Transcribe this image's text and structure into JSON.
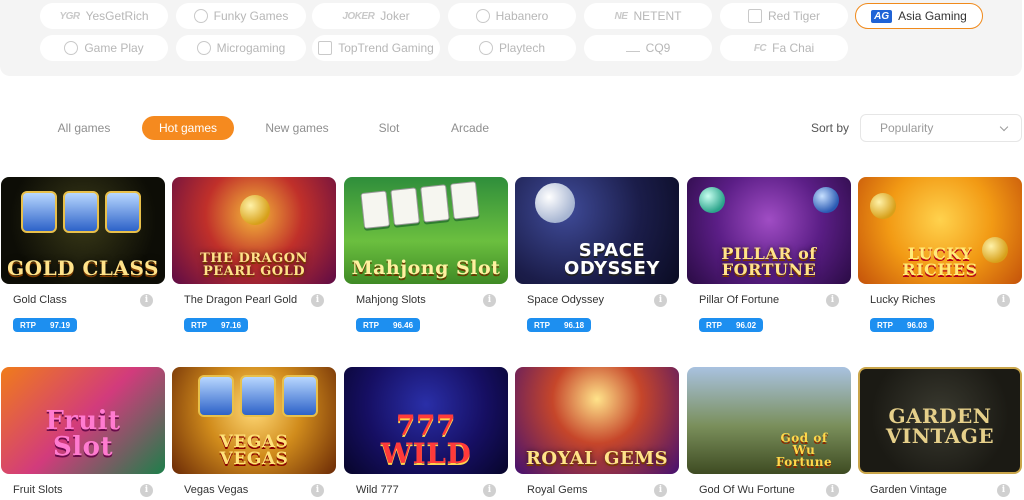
{
  "providers": [
    {
      "label": "YesGetRich",
      "icon": "ygr-logo-icon"
    },
    {
      "label": "Funky Games",
      "icon": "funky-games-logo-icon"
    },
    {
      "label": "Joker",
      "icon": "joker-logo-icon",
      "logo_text": "JOKER"
    },
    {
      "label": "Habanero",
      "icon": "habanero-logo-icon"
    },
    {
      "label": "NETENT",
      "icon": "netent-logo-icon",
      "logo_text": "NE"
    },
    {
      "label": "Red Tiger",
      "icon": "red-tiger-logo-icon"
    },
    {
      "label": "Asia Gaming",
      "icon": "asia-gaming-logo-icon",
      "logo_text": "AG",
      "active": true
    },
    {
      "label": "Game Play",
      "icon": "game-play-logo-icon"
    },
    {
      "label": "Microgaming",
      "icon": "microgaming-logo-icon"
    },
    {
      "label": "TopTrend Gaming",
      "icon": "toptrend-logo-icon"
    },
    {
      "label": "Playtech",
      "icon": "playtech-logo-icon"
    },
    {
      "label": "CQ9",
      "icon": "cq9-logo-icon"
    },
    {
      "label": "Fa Chai",
      "icon": "fa-chai-logo-icon",
      "logo_text": "FC"
    }
  ],
  "tabs": [
    {
      "label": "All games"
    },
    {
      "label": "Hot games",
      "active": true
    },
    {
      "label": "New games"
    },
    {
      "label": "Slot"
    },
    {
      "label": "Arcade"
    }
  ],
  "sort": {
    "label": "Sort by",
    "value": "Popularity"
  },
  "rtp_label": "RTP",
  "info_glyph": "i",
  "games": [
    {
      "name": "Gold Class",
      "thumb_text": "GOLD CLASS",
      "rtp": "97.19"
    },
    {
      "name": "The Dragon Pearl Gold",
      "thumb_text": "THE DRAGON PEARL GOLD",
      "rtp": "97.16"
    },
    {
      "name": "Mahjong Slots",
      "thumb_text": "Mahjong Slot",
      "rtp": "96.46"
    },
    {
      "name": "Space Odyssey",
      "thumb_text": "SPACE ODYSSEY",
      "rtp": "96.18"
    },
    {
      "name": "Pillar Of Fortune",
      "thumb_text": "PILLAR of FORTUNE",
      "rtp": "96.02"
    },
    {
      "name": "Lucky Riches",
      "thumb_text": "LUCKY RICHES",
      "rtp": "96.03"
    },
    {
      "name": "Fruit Slots",
      "thumb_text": "Fruit Slot"
    },
    {
      "name": "Vegas Vegas",
      "thumb_text": "VEGAS VEGAS"
    },
    {
      "name": "Wild 777",
      "thumb_text": "777 WILD"
    },
    {
      "name": "Royal Gems",
      "thumb_text": "ROYAL GEMS"
    },
    {
      "name": "God Of Wu Fortune",
      "thumb_text": "God of Wu Fortune"
    },
    {
      "name": "Garden Vintage",
      "thumb_text": "GARDEN VINTAGE"
    }
  ],
  "colors": {
    "accent": "#f58a1f",
    "rtp_badge": "#1d8ff0",
    "active_border": "#f08a1c"
  }
}
